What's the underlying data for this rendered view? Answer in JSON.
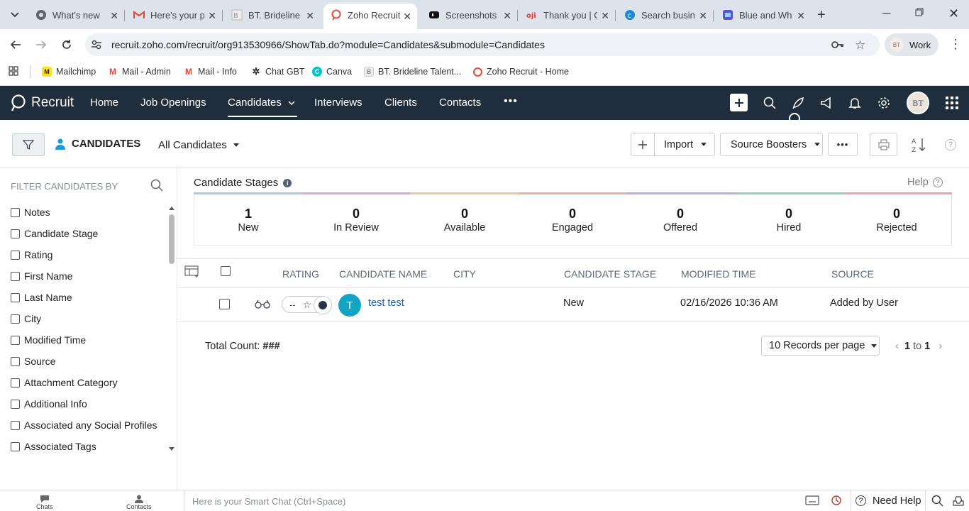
{
  "browser": {
    "tabs": [
      {
        "title": "What's new",
        "icon": "chrome-icon"
      },
      {
        "title": "Here's your p",
        "icon": "gmail-icon"
      },
      {
        "title": "BT. Brideline",
        "icon": "bt-icon"
      },
      {
        "title": "Zoho Recruit",
        "icon": "zoho-icon",
        "active": true
      },
      {
        "title": "Screenshots",
        "icon": "screenshots-icon"
      },
      {
        "title": "Thank you | G",
        "icon": "oji-icon"
      },
      {
        "title": "Search busin",
        "icon": "canva-icon"
      },
      {
        "title": "Blue and Wh",
        "icon": "blue-doc-icon"
      }
    ],
    "url": "recruit.zoho.com/recruit/org913530966/ShowTab.do?module=Candidates&submodule=Candidates",
    "profile": "Work",
    "bookmarks": [
      {
        "label": "Mailchimp",
        "color": "#ffe01b"
      },
      {
        "label": "Mail - Admin",
        "color": "#ea4335"
      },
      {
        "label": "Mail - Info",
        "color": "#ea4335"
      },
      {
        "label": "Chat GBT",
        "color": "#222222"
      },
      {
        "label": "Canva",
        "color": "#00c4cc"
      },
      {
        "label": "BT. Brideline Talent...",
        "color": "#cccccc"
      },
      {
        "label": "Zoho Recruit - Home",
        "color": "#e84c3d"
      }
    ]
  },
  "app": {
    "logo": "Recruit",
    "nav": {
      "home": "Home",
      "job_openings": "Job Openings",
      "candidates": "Candidates",
      "interviews": "Interviews",
      "clients": "Clients",
      "contacts": "Contacts"
    },
    "avatar_initials": "BT"
  },
  "subheader": {
    "module_title": "CANDIDATES",
    "view": "All Candidates",
    "import_label": "Import",
    "source_boosters_label": "Source Boosters"
  },
  "sidebar": {
    "heading": "FILTER CANDIDATES BY",
    "filters": [
      "Notes",
      "Candidate Stage",
      "Rating",
      "First Name",
      "Last Name",
      "City",
      "Modified Time",
      "Source",
      "Attachment Category",
      "Additional Info",
      "Associated any Social Profiles",
      "Associated Tags"
    ]
  },
  "stages": {
    "title": "Candidate Stages",
    "help": "Help",
    "items": [
      {
        "count": "1",
        "label": "New"
      },
      {
        "count": "0",
        "label": "In Review"
      },
      {
        "count": "0",
        "label": "Available"
      },
      {
        "count": "0",
        "label": "Engaged"
      },
      {
        "count": "0",
        "label": "Offered"
      },
      {
        "count": "0",
        "label": "Hired"
      },
      {
        "count": "0",
        "label": "Rejected"
      }
    ],
    "colors": [
      "#a9cbe8",
      "#d7a8d6",
      "#e9c79f",
      "#ebb0a3",
      "#b9aee4",
      "#8fd2b8",
      "#eca3ad"
    ]
  },
  "table": {
    "headers": {
      "rating": "RATING",
      "name": "CANDIDATE NAME",
      "city": "CITY",
      "stage": "CANDIDATE STAGE",
      "modified": "MODIFIED TIME",
      "source": "SOURCE"
    },
    "rows": [
      {
        "rating": "--",
        "avatar": "T",
        "name": "test test",
        "city": "",
        "stage": "New",
        "modified": "02/16/2026 10:36 AM",
        "source": "Added by User"
      }
    ]
  },
  "footer_bar": {
    "total_label": "Total Count:",
    "total_value": "###",
    "per_page": "10 Records per page",
    "page_from": "1",
    "page_to_word": "to",
    "page_to": "1"
  },
  "bottom": {
    "chats": "Chats",
    "contacts": "Contacts",
    "smart_chat_placeholder": "Here is your Smart Chat (Ctrl+Space)",
    "need_help": "Need Help"
  }
}
